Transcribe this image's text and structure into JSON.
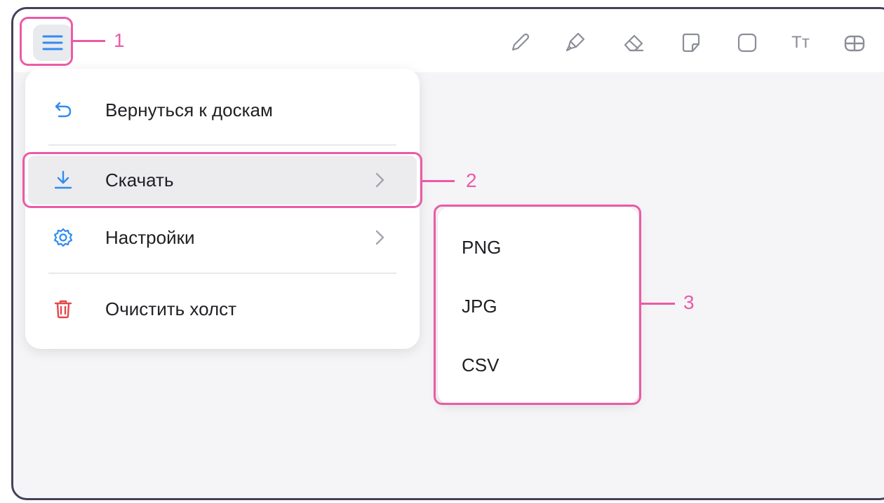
{
  "toolbar": {
    "menu_icon": "hamburger-icon",
    "tools": [
      "pencil-icon",
      "marker-icon",
      "eraser-icon",
      "sticky-note-icon",
      "shape-icon",
      "text-icon",
      "table-icon"
    ],
    "text_tool_label": "Tт"
  },
  "menu": {
    "items": [
      {
        "label": "Вернуться к доскам",
        "icon": "undo-arrow-icon"
      },
      {
        "label": "Скачать",
        "icon": "download-icon",
        "has_submenu": true
      },
      {
        "label": "Настройки",
        "icon": "gear-icon",
        "has_submenu": true
      },
      {
        "label": "Очистить холст",
        "icon": "trash-icon"
      }
    ]
  },
  "submenu": {
    "items": [
      "PNG",
      "JPG",
      "CSV"
    ]
  },
  "callouts": [
    "1",
    "2",
    "3"
  ],
  "colors": {
    "accent_blue": "#2f8cf0",
    "danger_red": "#e5484d",
    "highlight_pink": "#ec5aa6",
    "icon_gray": "#8b8e98"
  }
}
